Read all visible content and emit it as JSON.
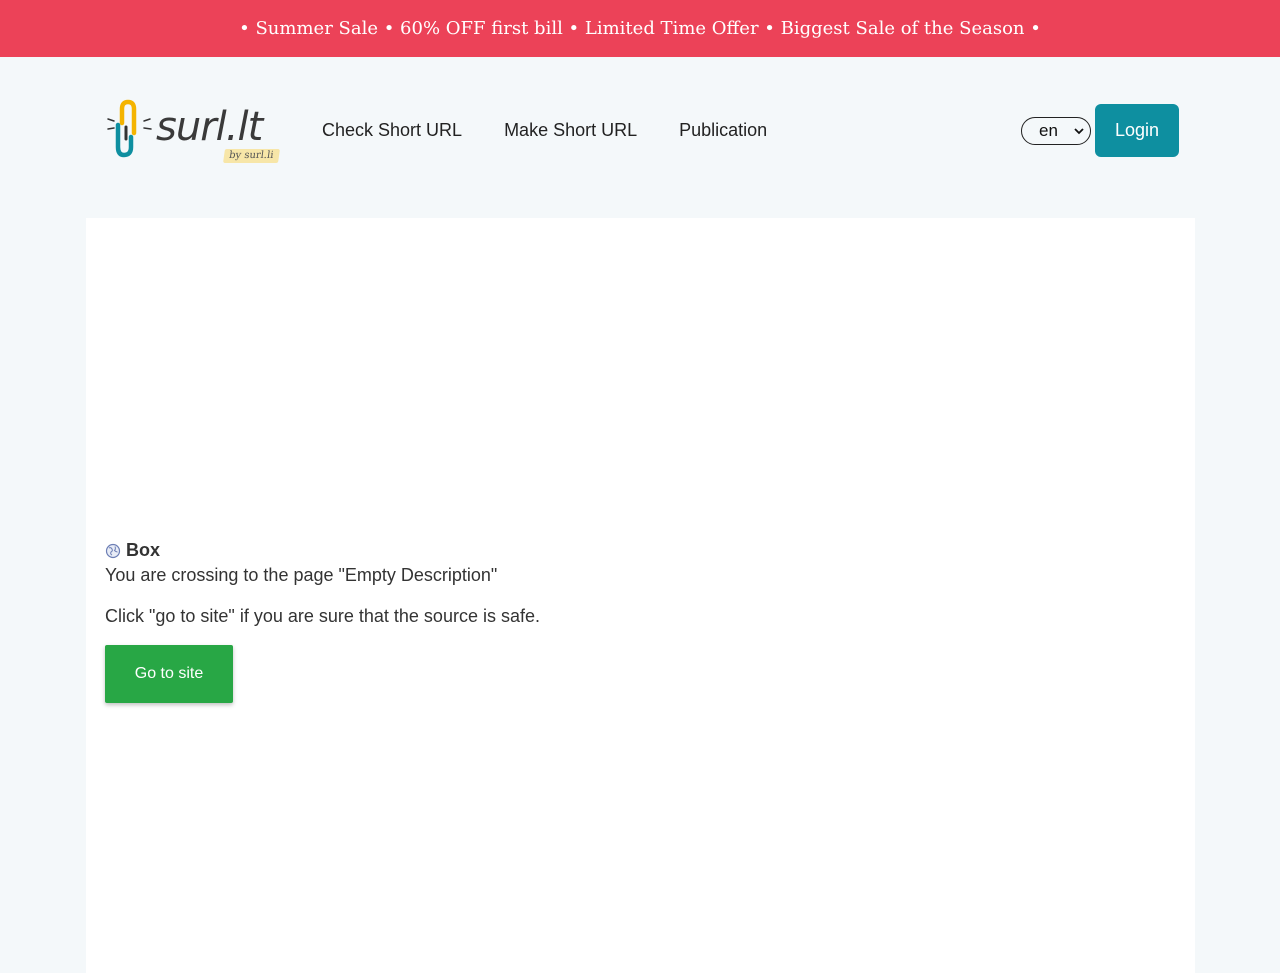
{
  "promo": {
    "text": "• Summer Sale • 60% OFF first bill • Limited Time Offer • Biggest Sale of the Season •"
  },
  "header": {
    "logo_text": "surl.lt",
    "logo_sub": "by surl.li",
    "nav": [
      {
        "label": "Check Short URL"
      },
      {
        "label": "Make Short URL"
      },
      {
        "label": "Publication"
      }
    ],
    "language": "en",
    "login_label": "Login"
  },
  "content": {
    "site_name": "Box",
    "crossing_text": "You are crossing to the page \"Empty Description\"",
    "safety_text": "Click \"go to site\" if you are sure that the source is safe.",
    "go_label": "Go to site"
  },
  "colors": {
    "promo_bg": "#ec4258",
    "accent": "#0e8fa0",
    "go_button": "#28a745",
    "page_bg": "#f4f8fa"
  },
  "icons": {
    "logo": "paperclip-logo-icon",
    "site": "globe-icon",
    "select": "chevron-down-icon"
  }
}
